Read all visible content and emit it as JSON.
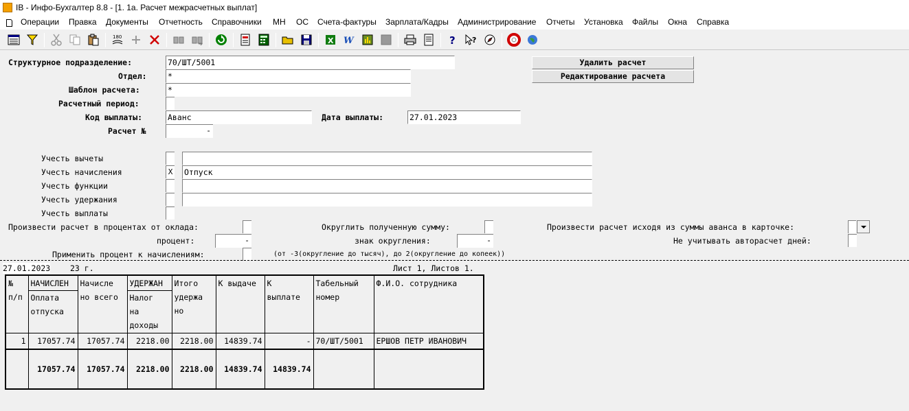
{
  "window": {
    "title": "IB - Инфо-Бухгалтер 8.8 - [1. 1а. Расчет межрасчетных выплат]"
  },
  "menu": [
    "Операции",
    "Правка",
    "Документы",
    "Отчетность",
    "Справочники",
    "МН",
    "ОС",
    "Счета-фактуры",
    "Зарплата/Кадры",
    "Администрирование",
    "Отчеты",
    "Установка",
    "Файлы",
    "Окна",
    "Справка"
  ],
  "toolbar": [
    "grid-icon",
    "filter-icon",
    "scissors-icon",
    "copy-icon",
    "paste-icon",
    "rotate-icon",
    "add-icon",
    "delete-icon",
    "find-icon",
    "find-next-icon",
    "refresh-icon",
    "document-icon",
    "calculator-icon",
    "open-folder-icon",
    "save-icon",
    "excel-icon",
    "word-icon",
    "chart-icon",
    "disabled-icon",
    "print-icon",
    "preview-icon",
    "help-icon",
    "context-help-icon",
    "compass-icon",
    "lifebuoy-icon",
    "globe-icon"
  ],
  "form": {
    "subdivision_label": "Структурное подразделение:",
    "subdivision_value": "70/ШТ/5001",
    "dept_label": "Отдел:",
    "dept_value": "*",
    "template_label": "Шаблон расчета:",
    "template_value": "*",
    "period_label": "Расчетный период:",
    "pay_code_label": "Код выплаты:",
    "pay_code_value": "Аванс",
    "pay_date_label": "Дата выплаты:",
    "pay_date_value": "27.01.2023",
    "calc_no_label": "Расчет №",
    "calc_no_dash": "-",
    "delete_button": "Удалить расчет",
    "edit_button": "Редактирование расчета",
    "include_deductions": "Учесть вычеты",
    "include_accruals": "Учесть начисления",
    "include_accruals_mark": "X",
    "include_accruals_value": "Отпуск",
    "include_functions": "Учесть функции",
    "include_withholdings": "Учесть удержания",
    "include_payments": "Учесть выплаты",
    "pct_salary_label": "Произвести расчет в процентах от оклада:",
    "round_sum_label": "Округлить полученную сумму:",
    "advance_card_label": "Произвести расчет исходя из суммы аванса в карточке:",
    "percent_label": "процент:",
    "percent_dash": "-",
    "round_sign_label": "знак округления:",
    "round_sign_dash": "-",
    "ignore_autocalc_label": "Не учитывать авторасчет дней:",
    "apply_pct_label": "Применить процент к начислениям:",
    "round_hint": "(от -3(округление до тысяч), до 2(округление до копеек))"
  },
  "report": {
    "date": "27.01.2023",
    "date_suffix": "23 г.",
    "sheet_info": "Лист 1, Листов 1.",
    "headers": {
      "no": [
        "№",
        "п/п"
      ],
      "accrued": [
        "НАЧИСЛЕН",
        "Оплата",
        "отпуска"
      ],
      "accrued_total": [
        "Начисле",
        "но всего"
      ],
      "withheld": [
        "УДЕРЖАН",
        "Налог",
        "на",
        "доходы"
      ],
      "withheld_total": [
        "Итого",
        "удержа",
        "но"
      ],
      "to_issue": [
        "К выдаче"
      ],
      "to_pay": [
        "К",
        "выплате"
      ],
      "tab_no": [
        "Табельный",
        "номер"
      ],
      "fio": [
        "Ф.И.О. сотрудника"
      ]
    },
    "rows": [
      {
        "no": "1",
        "accrued": "17057.74",
        "accrued_total": "17057.74",
        "withheld": "2218.00",
        "withheld_total": "2218.00",
        "to_issue": "14839.74",
        "to_pay": "-",
        "tab_no": "70/ШТ/5001",
        "fio": "ЕРШОВ ПЕТР ИВАНОВИЧ"
      }
    ],
    "total": {
      "accrued": "17057.74",
      "accrued_total": "17057.74",
      "withheld": "2218.00",
      "withheld_total": "2218.00",
      "to_issue": "14839.74",
      "to_pay": "14839.74"
    }
  }
}
